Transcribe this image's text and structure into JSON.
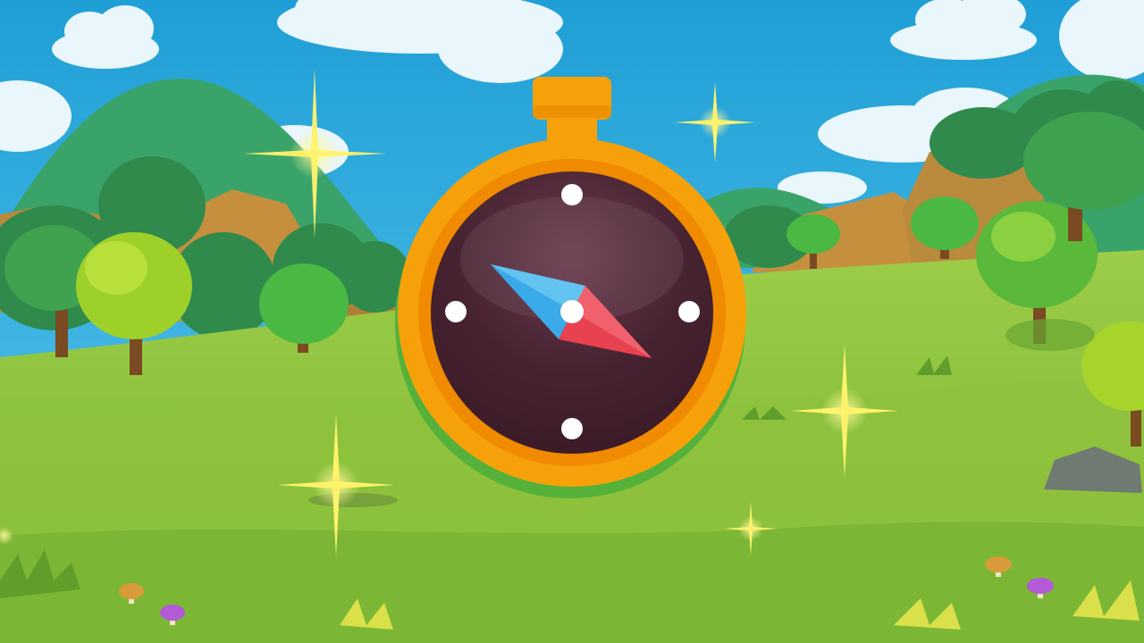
{
  "scene": {
    "kind": "game-scene",
    "setting": "cartoon-meadow",
    "time_of_day": "day",
    "sky_color": "#2aa7d8",
    "grass_color": "#8cc63f"
  },
  "compass": {
    "icon": "compass-icon",
    "case_color": "#f6a10a",
    "rim_color": "#f08a00",
    "shadow_color": "#55b13a",
    "face_color": "#3f1f2a",
    "needle_north_color": "#3aaae8",
    "needle_south_color": "#e8414f",
    "marker_color": "#ffffff"
  },
  "sparkles": {
    "count": 6,
    "color": "#fff36b"
  }
}
